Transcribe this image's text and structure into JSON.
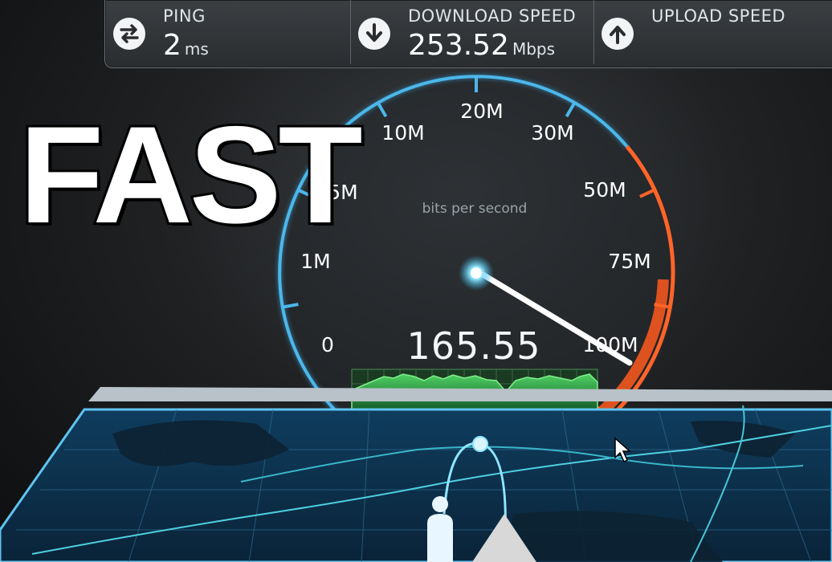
{
  "stats": {
    "ping": {
      "label": "PING",
      "value": "2",
      "unit": "ms",
      "icon": "swap-arrows-icon"
    },
    "download": {
      "label": "DOWNLOAD SPEED",
      "value": "253.52",
      "unit": "Mbps",
      "icon": "download-arrow-icon"
    },
    "upload": {
      "label": "UPLOAD SPEED",
      "value": "",
      "unit": "",
      "icon": "upload-arrow-icon"
    }
  },
  "gauge": {
    "unit_label": "bits per second",
    "readout": "165.55",
    "ticks": [
      {
        "label": "0"
      },
      {
        "label": "1M"
      },
      {
        "label": "5M"
      },
      {
        "label": "10M"
      },
      {
        "label": "20M"
      },
      {
        "label": "30M"
      },
      {
        "label": "50M"
      },
      {
        "label": "75M"
      },
      {
        "label": "100M"
      }
    ],
    "colors": {
      "low": "#3fa9d6",
      "high": "#ff5a1f",
      "needle": "#ffffff",
      "sparkline": "#5fd36a"
    }
  },
  "overlay": {
    "text": "FAST"
  },
  "colors": {
    "panel": "#2f3336",
    "accent_blue": "#39a6dd",
    "accent_orange": "#f26322"
  }
}
